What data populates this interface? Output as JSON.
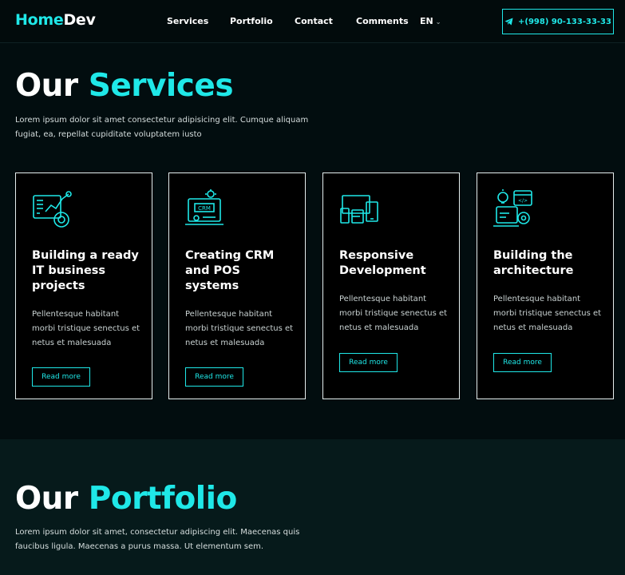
{
  "header": {
    "logo_part1": "Home",
    "logo_part2": "Dev",
    "nav": [
      "Services",
      "Portfolio",
      "Contact",
      "Comments"
    ],
    "language": "EN",
    "phone": "+(998) 90-133-33-33"
  },
  "services": {
    "title_white": "Our",
    "title_cyan": "Services",
    "description": "Lorem ipsum dolor sit amet consectetur adipisicing elit. Cumque aliquam fugiat, ea, repellat cupiditate voluptatem iusto",
    "cards": [
      {
        "icon": "analytics-dashboard-icon",
        "title": "Building a ready IT business projects",
        "text": "Pellentesque habitant morbi tristique senectus et netus et malesuada",
        "button": "Read more"
      },
      {
        "icon": "crm-laptop-icon",
        "title": "Creating CRM and POS systems",
        "text": "Pellentesque habitant morbi tristique senectus et netus et malesuada",
        "button": "Read more"
      },
      {
        "icon": "responsive-devices-icon",
        "title": "Responsive Development",
        "text": "Pellentesque habitant morbi tristique senectus et netus et malesuada",
        "button": "Read more"
      },
      {
        "icon": "architecture-code-icon",
        "title": "Building the architecture",
        "text": "Pellentesque habitant morbi tristique senectus et netus et malesuada",
        "button": "Read more"
      }
    ]
  },
  "portfolio": {
    "title_white": "Our",
    "title_cyan": "Portfolio",
    "description": "Lorem ipsum dolor sit amet, consectetur adipiscing elit. Maecenas quis faucibus ligula. Maecenas a purus massa. Ut elementum sem."
  },
  "colors": {
    "accent": "#1fe8e8",
    "background": "#020d0f",
    "portfolio_background": "#061a1b"
  }
}
